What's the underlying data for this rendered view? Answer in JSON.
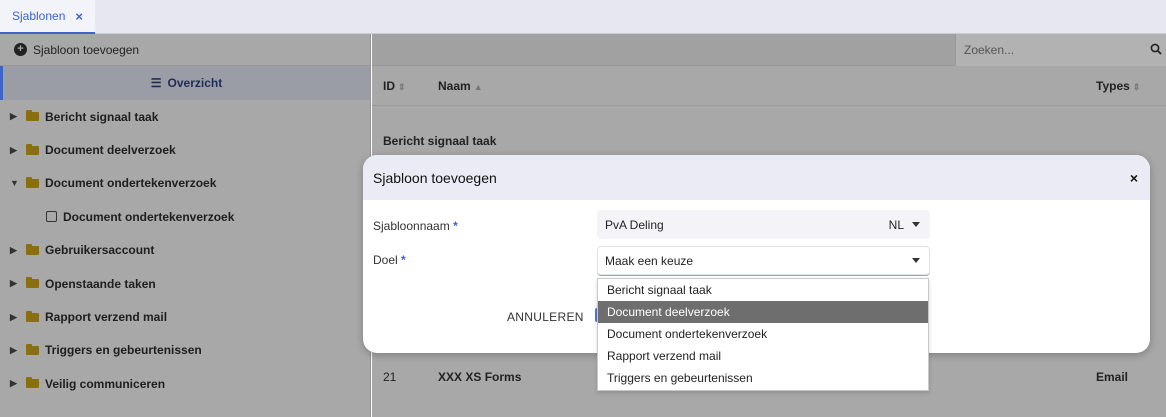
{
  "tabs": [
    {
      "label": "Sjablonen",
      "close": "×"
    }
  ],
  "sidebar": {
    "add_label": "Sjabloon toevoegen",
    "overview_label": "Overzicht",
    "items": [
      {
        "label": "Bericht signaal taak",
        "expanded": false
      },
      {
        "label": "Document deelverzoek",
        "expanded": false
      },
      {
        "label": "Document ondertekenverzoek",
        "expanded": true
      },
      {
        "label": "Document ondertekenverzoek",
        "child": true
      },
      {
        "label": "Gebruikersaccount",
        "expanded": false
      },
      {
        "label": "Openstaande taken",
        "expanded": false
      },
      {
        "label": "Rapport verzend mail",
        "expanded": false
      },
      {
        "label": "Triggers en gebeurtenissen",
        "expanded": false
      },
      {
        "label": "Veilig communiceren",
        "expanded": false
      }
    ]
  },
  "main": {
    "search_placeholder": "Zoeken...",
    "columns": {
      "id": "ID",
      "naam": "Naam",
      "types": "Types"
    },
    "group_label": "Bericht signaal taak",
    "row": {
      "id": "21",
      "naam": "XXX XS Forms",
      "type": "Email"
    }
  },
  "modal": {
    "title": "Sjabloon toevoegen",
    "close": "×",
    "name_label": "Sjabloonnaam",
    "name_value": "PvA Deling",
    "lang_value": "NL",
    "doel_label": "Doel",
    "doel_value": "Maak een keuze",
    "required_marker": "*",
    "cancel_label": "ANNULEREN"
  },
  "dropdown": {
    "options": [
      "Bericht signaal taak",
      "Document deelverzoek",
      "Document ondertekenverzoek",
      "Rapport verzend mail",
      "Triggers en gebeurtenissen"
    ],
    "highlighted": "Document deelverzoek"
  },
  "colors": {
    "accent": "#3e63c9",
    "dimmed_bg": "#a8a8a8",
    "highlight": "#6e6e6e"
  }
}
